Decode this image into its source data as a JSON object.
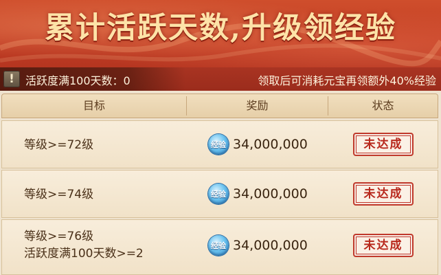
{
  "banner": {
    "title": "累计活跃天数,升级领经验"
  },
  "infobar": {
    "warn_icon": "exclamation-icon",
    "active_days_label": "活跃度满100天数：0",
    "bonus_note": "领取后可消耗元宝再领额外40%经验"
  },
  "table": {
    "headers": {
      "goal": "目标",
      "reward": "奖励",
      "status": "状态"
    },
    "rows": [
      {
        "goal_lines": [
          "等级>=72级"
        ],
        "reward_icon": "exp-icon",
        "reward_icon_text": "经验",
        "reward": "34,000,000",
        "status": "未达成"
      },
      {
        "goal_lines": [
          "等级>=74级"
        ],
        "reward_icon": "exp-icon",
        "reward_icon_text": "经验",
        "reward": "34,000,000",
        "status": "未达成"
      },
      {
        "goal_lines": [
          "等级>=76级",
          "活跃度满100天数>=2"
        ],
        "reward_icon": "exp-icon",
        "reward_icon_text": "经验",
        "reward": "34,000,000",
        "status": "未达成"
      }
    ]
  },
  "colors": {
    "banner_red": "#c23e24",
    "title_gold": "#fde3a8",
    "stamp_red": "#b8281c"
  }
}
